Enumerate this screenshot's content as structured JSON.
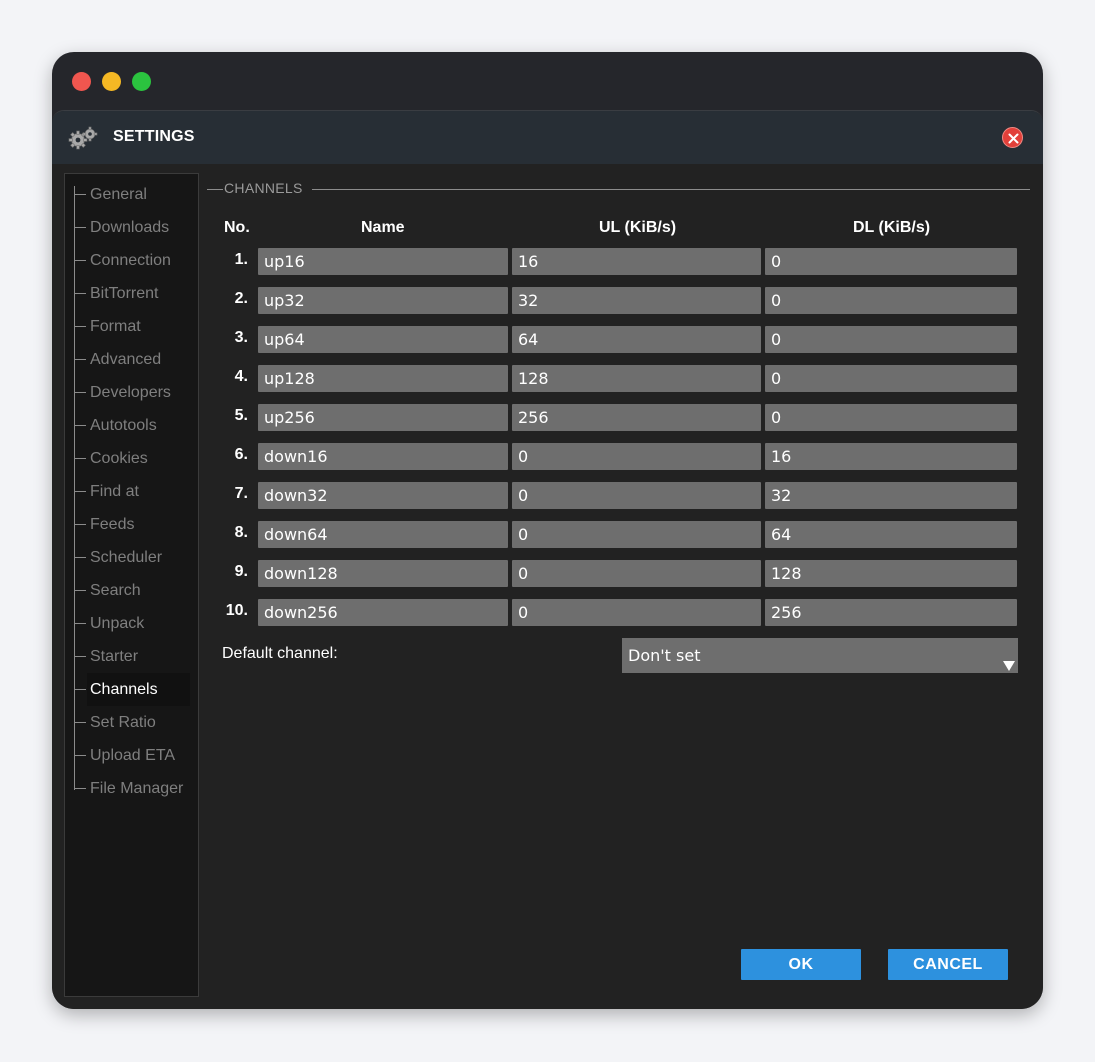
{
  "dialog": {
    "title": "SETTINGS",
    "icon": "gears-icon",
    "close_icon": "close-icon"
  },
  "sidebar": {
    "items": [
      {
        "label": "General",
        "active": false
      },
      {
        "label": "Downloads",
        "active": false
      },
      {
        "label": "Connection",
        "active": false
      },
      {
        "label": "BitTorrent",
        "active": false
      },
      {
        "label": "Format",
        "active": false
      },
      {
        "label": "Advanced",
        "active": false
      },
      {
        "label": "Developers",
        "active": false
      },
      {
        "label": "Autotools",
        "active": false
      },
      {
        "label": "Cookies",
        "active": false
      },
      {
        "label": "Find at",
        "active": false
      },
      {
        "label": "Feeds",
        "active": false
      },
      {
        "label": "Scheduler",
        "active": false
      },
      {
        "label": "Search",
        "active": false
      },
      {
        "label": "Unpack",
        "active": false
      },
      {
        "label": "Starter",
        "active": false
      },
      {
        "label": "Channels",
        "active": true
      },
      {
        "label": "Set Ratio",
        "active": false
      },
      {
        "label": "Upload ETA",
        "active": false
      },
      {
        "label": "File Manager",
        "active": false
      }
    ]
  },
  "section": {
    "title": "CHANNELS"
  },
  "table": {
    "headers": {
      "no": "No.",
      "name": "Name",
      "ul": "UL (KiB/s)",
      "dl": "DL (KiB/s)"
    },
    "rows": [
      {
        "no": "1.",
        "name": "up16",
        "ul": "16",
        "dl": "0"
      },
      {
        "no": "2.",
        "name": "up32",
        "ul": "32",
        "dl": "0"
      },
      {
        "no": "3.",
        "name": "up64",
        "ul": "64",
        "dl": "0"
      },
      {
        "no": "4.",
        "name": "up128",
        "ul": "128",
        "dl": "0"
      },
      {
        "no": "5.",
        "name": "up256",
        "ul": "256",
        "dl": "0"
      },
      {
        "no": "6.",
        "name": "down16",
        "ul": "0",
        "dl": "16"
      },
      {
        "no": "7.",
        "name": "down32",
        "ul": "0",
        "dl": "32"
      },
      {
        "no": "8.",
        "name": "down64",
        "ul": "0",
        "dl": "64"
      },
      {
        "no": "9.",
        "name": "down128",
        "ul": "0",
        "dl": "128"
      },
      {
        "no": "10.",
        "name": "down256",
        "ul": "0",
        "dl": "256"
      }
    ]
  },
  "default_channel": {
    "label": "Default channel:",
    "value": "Don't set"
  },
  "buttons": {
    "ok": "OK",
    "cancel": "CANCEL"
  },
  "colors": {
    "accent": "#2d91de",
    "field_bg": "#6e6e6e",
    "window_bg": "#222222",
    "titlebar_bg": "#272e35"
  }
}
